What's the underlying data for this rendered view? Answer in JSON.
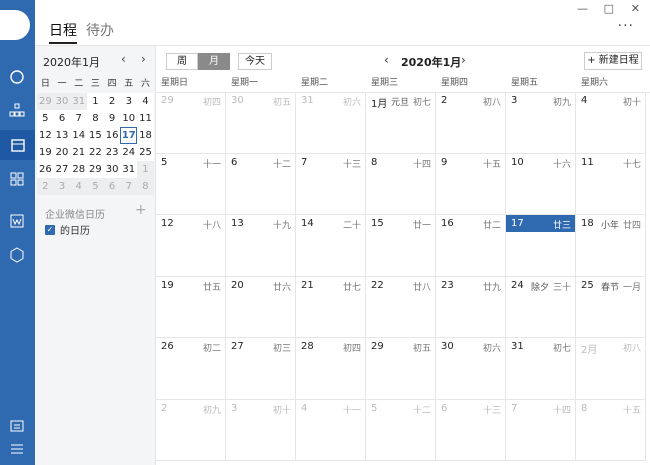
{
  "tabs": [
    "日程",
    "待办"
  ],
  "window": {
    "minimize": "—",
    "maximize": "□",
    "close": "✕",
    "more": "···"
  },
  "mini": {
    "header": "2020年1月",
    "prev": "‹",
    "next": "›",
    "weekdays": [
      "日",
      "一",
      "二",
      "三",
      "四",
      "五",
      "六"
    ],
    "weeks": [
      [
        "29",
        "30",
        "31",
        "1",
        "2",
        "3",
        "4"
      ],
      [
        "5",
        "6",
        "7",
        "8",
        "9",
        "10",
        "11"
      ],
      [
        "12",
        "13",
        "14",
        "15",
        "16",
        "17",
        "18"
      ],
      [
        "19",
        "20",
        "21",
        "22",
        "23",
        "24",
        "25"
      ],
      [
        "26",
        "27",
        "28",
        "29",
        "30",
        "31",
        "1"
      ],
      [
        "2",
        "3",
        "4",
        "5",
        "6",
        "7",
        "8"
      ]
    ]
  },
  "calendars": {
    "section": "企业微信日历",
    "plus": "+",
    "item": "的日历"
  },
  "toolbar": {
    "week": "周",
    "month": "月",
    "today": "今天",
    "prev": "‹",
    "next": "›",
    "title": "2020年1月",
    "new": "+ 新建日程"
  },
  "weekdays": [
    "星期日",
    "星期一",
    "星期二",
    "星期三",
    "星期四",
    "星期五",
    "星期六"
  ],
  "grid": [
    [
      {
        "d": "29",
        "l": "初四",
        "o": true
      },
      {
        "d": "30",
        "l": "初五",
        "o": true
      },
      {
        "d": "31",
        "l": "初六",
        "o": true
      },
      {
        "d": "1月",
        "l": "初七",
        "h": "元旦"
      },
      {
        "d": "2",
        "l": "初八"
      },
      {
        "d": "3",
        "l": "初九"
      },
      {
        "d": "4",
        "l": "初十"
      }
    ],
    [
      {
        "d": "5",
        "l": "十一"
      },
      {
        "d": "6",
        "l": "十二"
      },
      {
        "d": "7",
        "l": "十三"
      },
      {
        "d": "8",
        "l": "十四"
      },
      {
        "d": "9",
        "l": "十五"
      },
      {
        "d": "10",
        "l": "十六"
      },
      {
        "d": "11",
        "l": "十七"
      }
    ],
    [
      {
        "d": "12",
        "l": "十八"
      },
      {
        "d": "13",
        "l": "十九"
      },
      {
        "d": "14",
        "l": "二十"
      },
      {
        "d": "15",
        "l": "廿一"
      },
      {
        "d": "16",
        "l": "廿二"
      },
      {
        "d": "17",
        "l": "廿三",
        "t": true
      },
      {
        "d": "18",
        "l": "廿四",
        "h": "小年"
      }
    ],
    [
      {
        "d": "19",
        "l": "廿五"
      },
      {
        "d": "20",
        "l": "廿六"
      },
      {
        "d": "21",
        "l": "廿七"
      },
      {
        "d": "22",
        "l": "廿八"
      },
      {
        "d": "23",
        "l": "廿九"
      },
      {
        "d": "24",
        "l": "三十",
        "h": "除夕"
      },
      {
        "d": "25",
        "l": "一月",
        "h": "春节"
      }
    ],
    [
      {
        "d": "26",
        "l": "初二"
      },
      {
        "d": "27",
        "l": "初三"
      },
      {
        "d": "28",
        "l": "初四"
      },
      {
        "d": "29",
        "l": "初五"
      },
      {
        "d": "30",
        "l": "初六"
      },
      {
        "d": "31",
        "l": "初七"
      },
      {
        "d": "2月",
        "l": "初八",
        "o": true
      }
    ],
    [
      {
        "d": "2",
        "l": "初九",
        "o": true
      },
      {
        "d": "3",
        "l": "初十",
        "o": true
      },
      {
        "d": "4",
        "l": "十一",
        "o": true
      },
      {
        "d": "5",
        "l": "十二",
        "o": true
      },
      {
        "d": "6",
        "l": "十三",
        "o": true
      },
      {
        "d": "7",
        "l": "十四",
        "o": true
      },
      {
        "d": "8",
        "l": "十五",
        "o": true
      }
    ]
  ]
}
